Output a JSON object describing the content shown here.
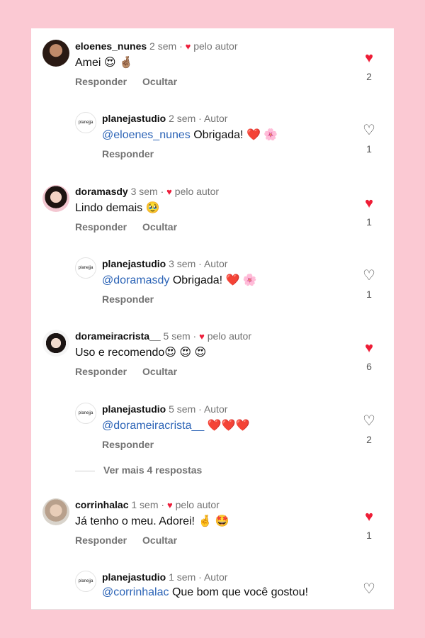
{
  "colors": {
    "background": "#fbc9d3",
    "mention": "#2b63b6",
    "heart": "#ee1d36"
  },
  "comments": [
    {
      "user": "eloenes_nunes",
      "time": "2 sem",
      "badge": "pelo autor",
      "text": "Amei 😍 🤞🏽",
      "reply": "Responder",
      "hide": "Ocultar",
      "likes": "2"
    },
    {
      "user": "planejastudio",
      "time": "2 sem",
      "badge": "Autor",
      "mention": "@eloenes_nunes",
      "text": "Obrigada! ❤️ 🌸",
      "reply": "Responder",
      "likes": "1"
    },
    {
      "user": "doramasdy",
      "time": "3 sem",
      "badge": "pelo autor",
      "text": "Lindo demais 🥹",
      "reply": "Responder",
      "hide": "Ocultar",
      "likes": "1"
    },
    {
      "user": "planejastudio",
      "time": "3 sem",
      "badge": "Autor",
      "mention": "@doramasdy",
      "text": "Obrigada! ❤️ 🌸",
      "reply": "Responder",
      "likes": "1"
    },
    {
      "user": "dorameiracrista__",
      "time": "5 sem",
      "badge": "pelo autor",
      "text": "Uso e recomendo😍 😍 😍",
      "reply": "Responder",
      "hide": "Ocultar",
      "likes": "6"
    },
    {
      "user": "planejastudio",
      "time": "5 sem",
      "badge": "Autor",
      "mention": "@dorameiracrista__",
      "text": "❤️❤️❤️",
      "reply": "Responder",
      "likes": "2"
    },
    {
      "user": "corrinhalac",
      "time": "1 sem",
      "badge": "pelo autor",
      "text": "Já tenho o meu. Adorei! 🤞 🤩",
      "reply": "Responder",
      "hide": "Ocultar",
      "likes": "1"
    },
    {
      "user": "planejastudio",
      "time": "1 sem",
      "badge": "Autor",
      "mention": "@corrinhalac",
      "text": "Que bom que você gostou!"
    }
  ],
  "more_replies": "Ver mais 4 respostas",
  "reply_avatar_text": "planejja",
  "dot": "·",
  "heart_filled": "♥",
  "heart_outline": "♡"
}
